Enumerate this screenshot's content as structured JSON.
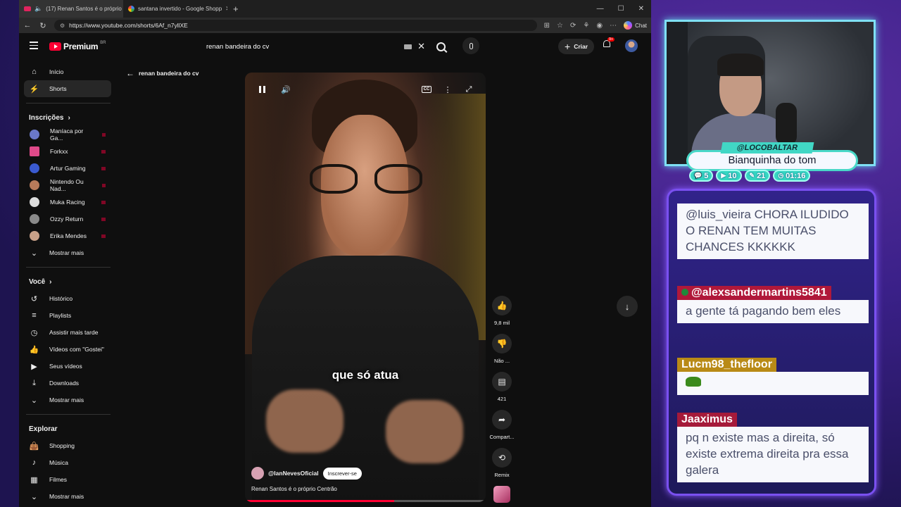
{
  "browser": {
    "tabs": [
      {
        "title": "(17) Renan Santos é o próprio",
        "active": true
      },
      {
        "title": "santana invertido - Google Shopp",
        "active": false
      }
    ],
    "url": "https://www.youtube.com/shorts/6Af_n7yllXE",
    "chat_label": "Chat"
  },
  "youtube": {
    "logo_text": "Premium",
    "logo_region": "BR",
    "search_query": "renan bandeira do cv",
    "create_label": "Criar",
    "notification_badge": "9+",
    "sidebar": {
      "main": [
        {
          "label": "Início",
          "icon": "home-icon"
        },
        {
          "label": "Shorts",
          "icon": "shorts-icon",
          "active": true
        }
      ],
      "subscriptions_heading": "Inscrições",
      "subscriptions": [
        {
          "label": "Maníaca por Ga...",
          "color": "#6a78c8"
        },
        {
          "label": "Forkxx",
          "color": "#e04a8a"
        },
        {
          "label": "Artur Gaming",
          "color": "#3a5ad0"
        },
        {
          "label": "Nintendo Ou Nad...",
          "color": "#b87a5a"
        },
        {
          "label": "Muka Racing",
          "color": "#ddd"
        },
        {
          "label": "Ozzy Return",
          "color": "#8a8a8a"
        },
        {
          "label": "Erika Mendes",
          "color": "#c8a088"
        },
        {
          "label": "Mostrar mais",
          "icon": "chevron-down-icon"
        }
      ],
      "you_heading": "Você",
      "you": [
        {
          "label": "Histórico",
          "icon": "history-icon"
        },
        {
          "label": "Playlists",
          "icon": "playlist-icon"
        },
        {
          "label": "Assistir mais tarde",
          "icon": "clock-icon"
        },
        {
          "label": "Vídeos com \"Gostei\"",
          "icon": "thumbs-up-icon"
        },
        {
          "label": "Seus vídeos",
          "icon": "video-icon"
        },
        {
          "label": "Downloads",
          "icon": "download-icon"
        },
        {
          "label": "Mostrar mais",
          "icon": "chevron-down-icon"
        }
      ],
      "explore_heading": "Explorar",
      "explore": [
        {
          "label": "Shopping",
          "icon": "shopping-bag-icon"
        },
        {
          "label": "Música",
          "icon": "music-note-icon"
        },
        {
          "label": "Filmes",
          "icon": "film-icon"
        },
        {
          "label": "Mostrar mais",
          "icon": "chevron-down-icon"
        }
      ]
    },
    "back_label": "renan bandeira do cv",
    "video": {
      "caption": "que só atua",
      "channel": "@IanNevesOficial",
      "subscribe_label": "Inscrever-se",
      "title": "Renan Santos é o próprio Centrão",
      "progress": 0.62
    },
    "actions": {
      "like_count": "9,8 mil",
      "dislike_label": "Não ...",
      "comment_count": "421",
      "share_label": "Compart...",
      "remix_label": "Remix"
    }
  },
  "stream": {
    "handle": "@LOCOBALTAR",
    "song": "Bianquinha do tom",
    "stats": [
      {
        "icon": "chat-icon",
        "value": "5"
      },
      {
        "icon": "youtube-icon",
        "value": "10"
      },
      {
        "icon": "tip-icon",
        "value": "21"
      },
      {
        "icon": "timer-icon",
        "value": "01:16"
      }
    ],
    "chat": [
      {
        "user": "",
        "text": "@luis_vieira CHORA ILUDIDO O RENAN TEM MUITAS CHANCES KKKKKK"
      },
      {
        "user": "@alexsandermartins5841",
        "text": "a gente tá pagando bem eles"
      },
      {
        "user": "Lucm98_thefloor",
        "text": ""
      },
      {
        "user": "Jaaximus",
        "text": "pq n existe mas a direita, só existe extrema direita pra essa galera"
      }
    ]
  }
}
